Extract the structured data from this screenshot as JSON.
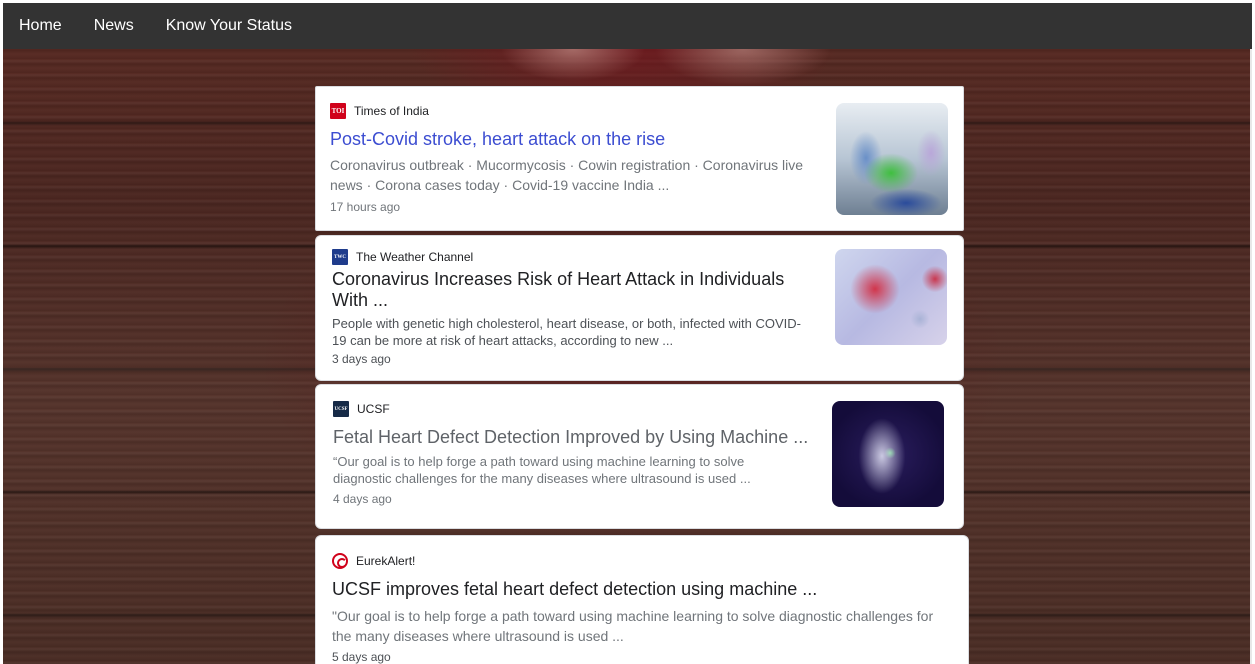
{
  "nav": {
    "items": [
      {
        "label": "Home"
      },
      {
        "label": "News"
      },
      {
        "label": "Know Your Status"
      }
    ]
  },
  "articles": [
    {
      "source": "Times of India",
      "source_logo_text": "TOI",
      "headline": "Post-Covid stroke, heart attack on the rise",
      "snippet": "Coronavirus outbreak · Mucormycosis · Cowin registration · Coronavirus live news · Corona cases today · Covid-19 vaccine India ...",
      "time": "17 hours ago",
      "thumbnail_icon": "hospital-photo"
    },
    {
      "source": "The Weather Channel",
      "source_logo_text": "TWC",
      "headline": "Coronavirus Increases Risk of Heart Attack in Individuals With ...",
      "snippet": "People with genetic high cholesterol, heart disease, or both, infected with COVID-19 can be more at risk of heart attacks, according to new ...",
      "time": "3 days ago",
      "thumbnail_icon": "virus-illustration"
    },
    {
      "source": "UCSF",
      "source_logo_text": "UCSF",
      "headline": "Fetal Heart Defect Detection Improved by Using Machine ...",
      "snippet": "“Our goal is to help forge a path toward using machine learning to solve diagnostic challenges for the many diseases where ultrasound is used ...",
      "time": "4 days ago",
      "thumbnail_icon": "ultrasound-image"
    },
    {
      "source": "EurekAlert!",
      "source_logo_text": "",
      "headline": "UCSF improves fetal heart defect detection using machine ...",
      "snippet": "\"Our goal is to help forge a path toward using machine learning to solve diagnostic challenges for the many diseases where ultrasound is used ...",
      "time": "5 days ago"
    }
  ],
  "colors": {
    "navbar_bg": "#333333",
    "link_blue": "#3c4dd1",
    "card_bg": "#ffffff"
  }
}
